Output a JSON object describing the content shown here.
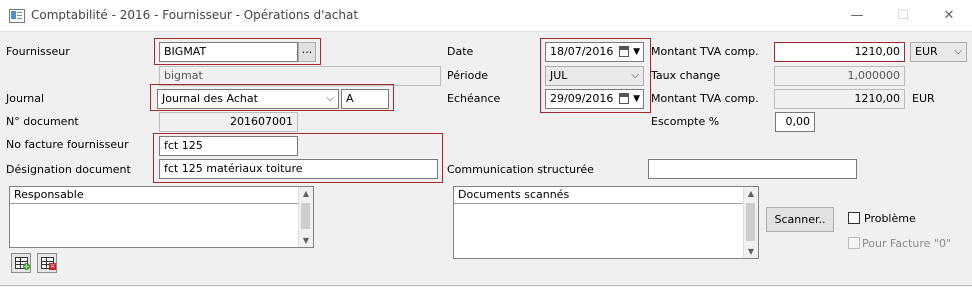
{
  "window": {
    "title": "Comptabilité - 2016 - Fournisseur - Opérations d'achat",
    "minimize": "—",
    "maximize": "☐",
    "close": "✕"
  },
  "form": {
    "fournisseur": {
      "label": "Fournisseur",
      "code": "BIGMAT",
      "name": "bigmat",
      "browse": "..."
    },
    "journal": {
      "label": "Journal",
      "value": "Journal des Achat",
      "code": "A"
    },
    "no_document": {
      "label": "N° document",
      "value": "201607001"
    },
    "no_facture": {
      "label": "No facture fournisseur",
      "value": "fct 125"
    },
    "designation": {
      "label": "Désignation document",
      "value": "fct 125 matériaux toiture"
    },
    "date": {
      "label": "Date",
      "value": "18/07/2016"
    },
    "periode": {
      "label": "Période",
      "value": "JUL"
    },
    "echeance": {
      "label": "Echéance",
      "value": "29/09/2016"
    },
    "communication": {
      "label": "Communication structurée",
      "value": ""
    },
    "montant_tva": {
      "label": "Montant TVA comp.",
      "value": "1210,00",
      "currency": "EUR"
    },
    "taux_change": {
      "label": "Taux change",
      "value": "1,000000"
    },
    "montant_tva2": {
      "label": "Montant TVA comp.",
      "value": "1210,00",
      "currency": "EUR"
    },
    "escompte": {
      "label": "Escompte %",
      "value": "0,00"
    }
  },
  "panels": {
    "responsable": {
      "header": "Responsable"
    },
    "documents": {
      "header": "Documents scannés"
    }
  },
  "actions": {
    "scanner": "Scanner..",
    "probleme": "Problème",
    "pour_facture": "Pour Facture \"0\""
  },
  "icons": {
    "add": "add-row-icon",
    "delete": "delete-row-icon"
  }
}
